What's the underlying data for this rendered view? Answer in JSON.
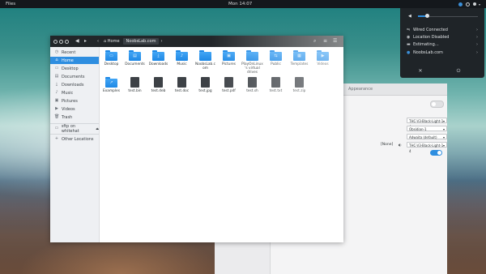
{
  "topbar": {
    "app_name": "Files",
    "clock": "Mon 14:07"
  },
  "system_menu": {
    "items": [
      {
        "icon": "wired-icon",
        "label": "Wired Connected"
      },
      {
        "icon": "location-icon",
        "label": "Location Disabled"
      },
      {
        "icon": "battery-icon",
        "label": "Estimating…"
      },
      {
        "icon": "user-icon",
        "label": "NoobsLab.com"
      }
    ],
    "volume_level": 0.15,
    "accent": "#2e8ee0"
  },
  "files": {
    "breadcrumbs": [
      "Home",
      "NoobsLab.com"
    ],
    "sidebar": [
      {
        "icon": "recent-icon",
        "label": "Recent"
      },
      {
        "icon": "home-icon",
        "label": "Home"
      },
      {
        "icon": "desktop-icon",
        "label": "Desktop"
      },
      {
        "icon": "documents-icon",
        "label": "Documents"
      },
      {
        "icon": "downloads-icon",
        "label": "Downloads"
      },
      {
        "icon": "music-icon",
        "label": "Music"
      },
      {
        "icon": "pictures-icon",
        "label": "Pictures"
      },
      {
        "icon": "videos-icon",
        "label": "Videos"
      },
      {
        "icon": "trash-icon",
        "label": "Trash"
      },
      {
        "icon": "network-icon",
        "label": "sftp on whitehat"
      },
      {
        "icon": "plus-icon",
        "label": "Other Locations"
      }
    ],
    "folders": [
      {
        "name": "Desktop",
        "symbol": "▭"
      },
      {
        "name": "Documents",
        "symbol": "▤"
      },
      {
        "name": "Downloads",
        "symbol": "⤓"
      },
      {
        "name": "Music",
        "symbol": "♪"
      },
      {
        "name": "NoobsLab.com",
        "symbol": ""
      },
      {
        "name": "Pictures",
        "symbol": "▣"
      },
      {
        "name": "PlayOnLinux's virtual drives",
        "symbol": ""
      },
      {
        "name": "Public",
        "symbol": "⇆"
      },
      {
        "name": "Templates",
        "symbol": "▦"
      },
      {
        "name": "Videos",
        "symbol": "▶"
      }
    ],
    "files_row": [
      {
        "name": "Examples",
        "kind": "folder",
        "symbol": "↗"
      },
      {
        "name": "test.bin",
        "kind": "doc"
      },
      {
        "name": "test.deb",
        "kind": "doc"
      },
      {
        "name": "test.doc",
        "kind": "doc"
      },
      {
        "name": "test.jpg",
        "kind": "doc"
      },
      {
        "name": "test.pdf",
        "kind": "doc"
      },
      {
        "name": "test.sh",
        "kind": "doc"
      },
      {
        "name": "test.txt",
        "kind": "doc"
      },
      {
        "name": "test.zip",
        "kind": "doc"
      }
    ]
  },
  "settings": {
    "title": "Appearance",
    "combos": [
      "THC-V3-Black-Light-1-4",
      "Obsidian-1",
      "Adwaita (default)",
      "THC-V3-Black-Light-1-4"
    ],
    "extra_label": "[None]"
  }
}
